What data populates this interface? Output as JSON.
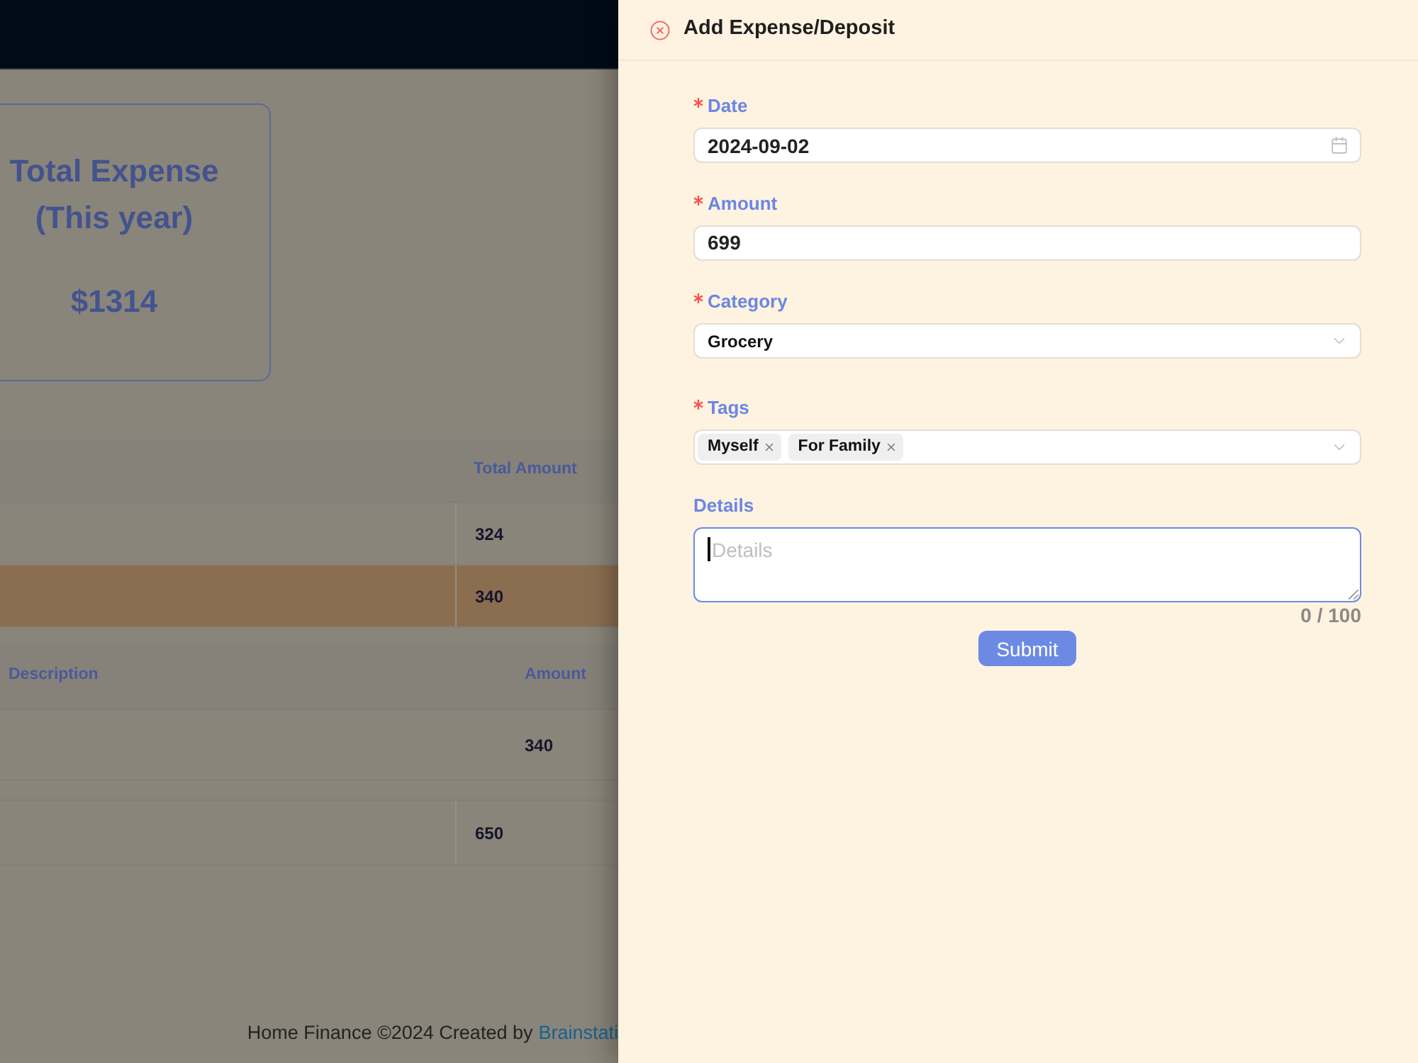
{
  "summary_card": {
    "title": "Total Expense (This year)",
    "amount": "$1314"
  },
  "totals_table": {
    "columns": [
      "Total Amount"
    ],
    "rows": [
      {
        "total_amount": "324",
        "selected": false
      },
      {
        "total_amount": "340",
        "selected": true
      }
    ]
  },
  "expenses_table": {
    "columns": [
      "Description",
      "Amount"
    ],
    "rows": [
      {
        "amount": "340"
      }
    ]
  },
  "table_3": {
    "rows": [
      {
        "column_2": "650"
      }
    ]
  },
  "footer": {
    "text": "Home Finance ©2024 Created by",
    "link": "Brainstati"
  },
  "drawer": {
    "title": "Add Expense/Deposit",
    "fields": [
      {
        "kind": "date",
        "label": "Date",
        "required": true,
        "value": "2024-09-02"
      },
      {
        "kind": "text",
        "label": "Amount",
        "required": true,
        "value": "699"
      },
      {
        "kind": "select",
        "label": "Category",
        "required": true,
        "value": "Grocery"
      },
      {
        "kind": "tags",
        "label": "Tags",
        "required": true,
        "tags": [
          "Myself",
          "For Family"
        ]
      },
      {
        "kind": "textarea",
        "label": "Details",
        "required": false,
        "placeholder": "Details",
        "focused": true,
        "counter": "0 / 100"
      }
    ],
    "submit": "Submit"
  }
}
